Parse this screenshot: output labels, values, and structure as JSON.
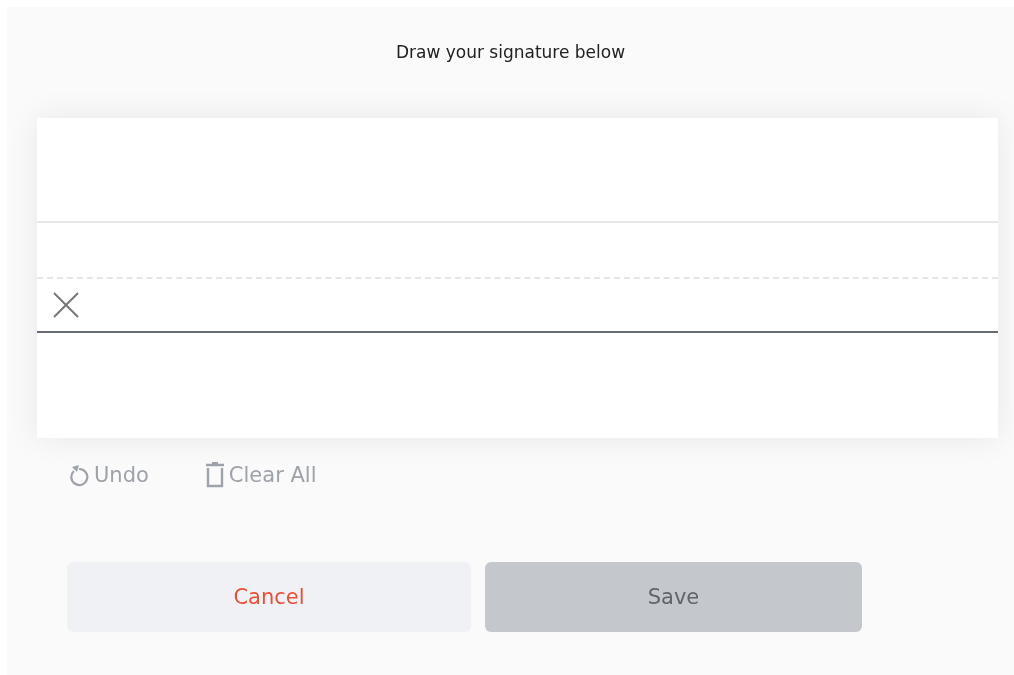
{
  "title": "Draw your signature below",
  "tools": [
    {
      "kind": "undo",
      "label": "Undo",
      "disabled": true
    },
    {
      "kind": "clear",
      "label": "Clear All",
      "disabled": true
    }
  ],
  "buttons": [
    {
      "kind": "cancel",
      "label": "Cancel",
      "disabled": false
    },
    {
      "kind": "save",
      "label": "Save",
      "disabled": true
    }
  ]
}
